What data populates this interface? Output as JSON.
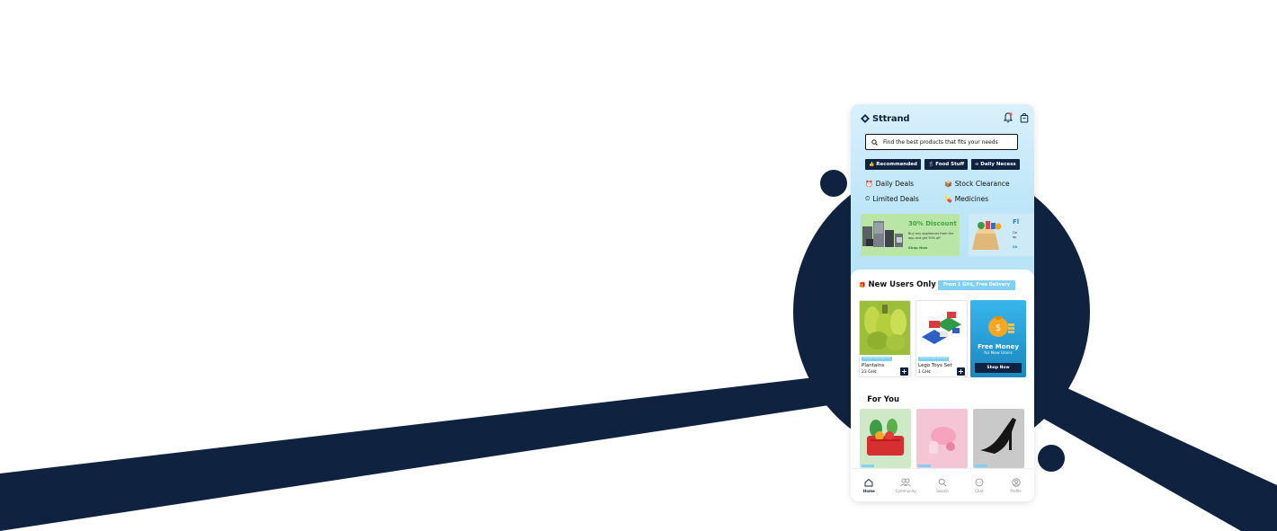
{
  "app": {
    "brand": "Sttrand"
  },
  "search": {
    "placeholder": "Find the best products that fits your needs"
  },
  "chips": [
    {
      "label": "Recommended",
      "icon": "thumbs-up-icon"
    },
    {
      "label": "Food Stuff",
      "icon": "food-icon"
    },
    {
      "label": "Daily Necess",
      "icon": "infinity-icon"
    }
  ],
  "deals": [
    {
      "label": "Daily Deals",
      "icon": "clock-icon"
    },
    {
      "label": "Stock Clearance",
      "icon": "boxes-icon"
    },
    {
      "label": "Limited Deals",
      "icon": "timer-icon"
    },
    {
      "label": "Medicines",
      "icon": "pill-icon"
    }
  ],
  "banners": [
    {
      "title": "30% Discount",
      "desc": "Buy any appliances from the app and get 30% off",
      "cta": "Shop Now"
    },
    {
      "title": "Fl",
      "desc": "Ge\nap",
      "cta": "Sh"
    }
  ],
  "new_users": {
    "title": "New Users Only",
    "pill": "From 1 GH₵, Free Delivery",
    "products": [
      {
        "badge": "First Purchase Discount",
        "name": "Plantains",
        "price": "23 GH₵"
      },
      {
        "badge": "First Purchase Discount",
        "name": "Lego Toys Set",
        "price": "1 GH₵"
      }
    ],
    "promo": {
      "title": "Free Money",
      "subtitle": "for New Users",
      "cta": "Shop Now"
    }
  },
  "for_you": {
    "title": "For You"
  },
  "tabs": [
    {
      "label": "Home",
      "icon": "home-icon",
      "active": true
    },
    {
      "label": "Community",
      "icon": "community-icon",
      "active": false
    },
    {
      "label": "Search",
      "icon": "search-icon",
      "active": false
    },
    {
      "label": "Chat",
      "icon": "chat-icon",
      "active": false
    },
    {
      "label": "Profile",
      "icon": "profile-icon",
      "active": false
    }
  ],
  "colors": {
    "navy": "#0f2340",
    "accent_blue": "#7fd0f3",
    "hero_bg": "#bfe7f8"
  }
}
